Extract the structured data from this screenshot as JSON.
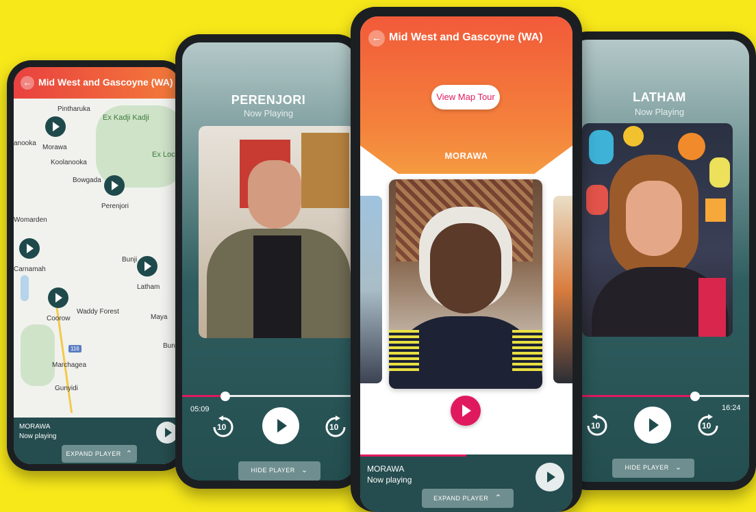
{
  "region_title": "Mid West and Gascoyne (WA)",
  "phone_map": {
    "header": "Mid West and Gascoyne (WA)",
    "places": [
      "Pintharuka",
      "Ex Kadji Kadji",
      "anooka",
      "Morawa",
      "Koolanooka",
      "Bowgada",
      "Perenjori",
      "Ex Loc",
      "Womarden",
      "Carnamah",
      "Bunji",
      "Latham",
      "Coorow",
      "Waddy Forest",
      "Maya",
      "Bun",
      "116",
      "Marchagea",
      "Gunyidi"
    ],
    "footer": {
      "name": "MORAWA",
      "status": "Now playing",
      "expand": "EXPAND PLAYER"
    }
  },
  "phone_perenjori": {
    "title": "PERENJORI",
    "status": "Now Playing",
    "time": "05:09",
    "progress": 0.25,
    "skip_back": "10",
    "skip_fwd": "10",
    "hide": "HIDE PLAYER"
  },
  "phone_morawa": {
    "header": "Mid West and Gascoyne (WA)",
    "cta": "View Map Tour",
    "title": "MORAWA",
    "footer": {
      "name": "MORAWA",
      "status": "Now playing",
      "expand": "EXPAND PLAYER"
    },
    "progress": 0.5
  },
  "phone_latham": {
    "title": "LATHAM",
    "status": "Now Playing",
    "time": "16:24",
    "progress": 0.7,
    "skip_back": "10",
    "skip_fwd": "10",
    "hide": "HIDE PLAYER"
  },
  "colors": {
    "background": "#f7e81a",
    "header_orange": "#f26c3d",
    "accent_pink": "#e0195f",
    "teal": "#244e50"
  }
}
